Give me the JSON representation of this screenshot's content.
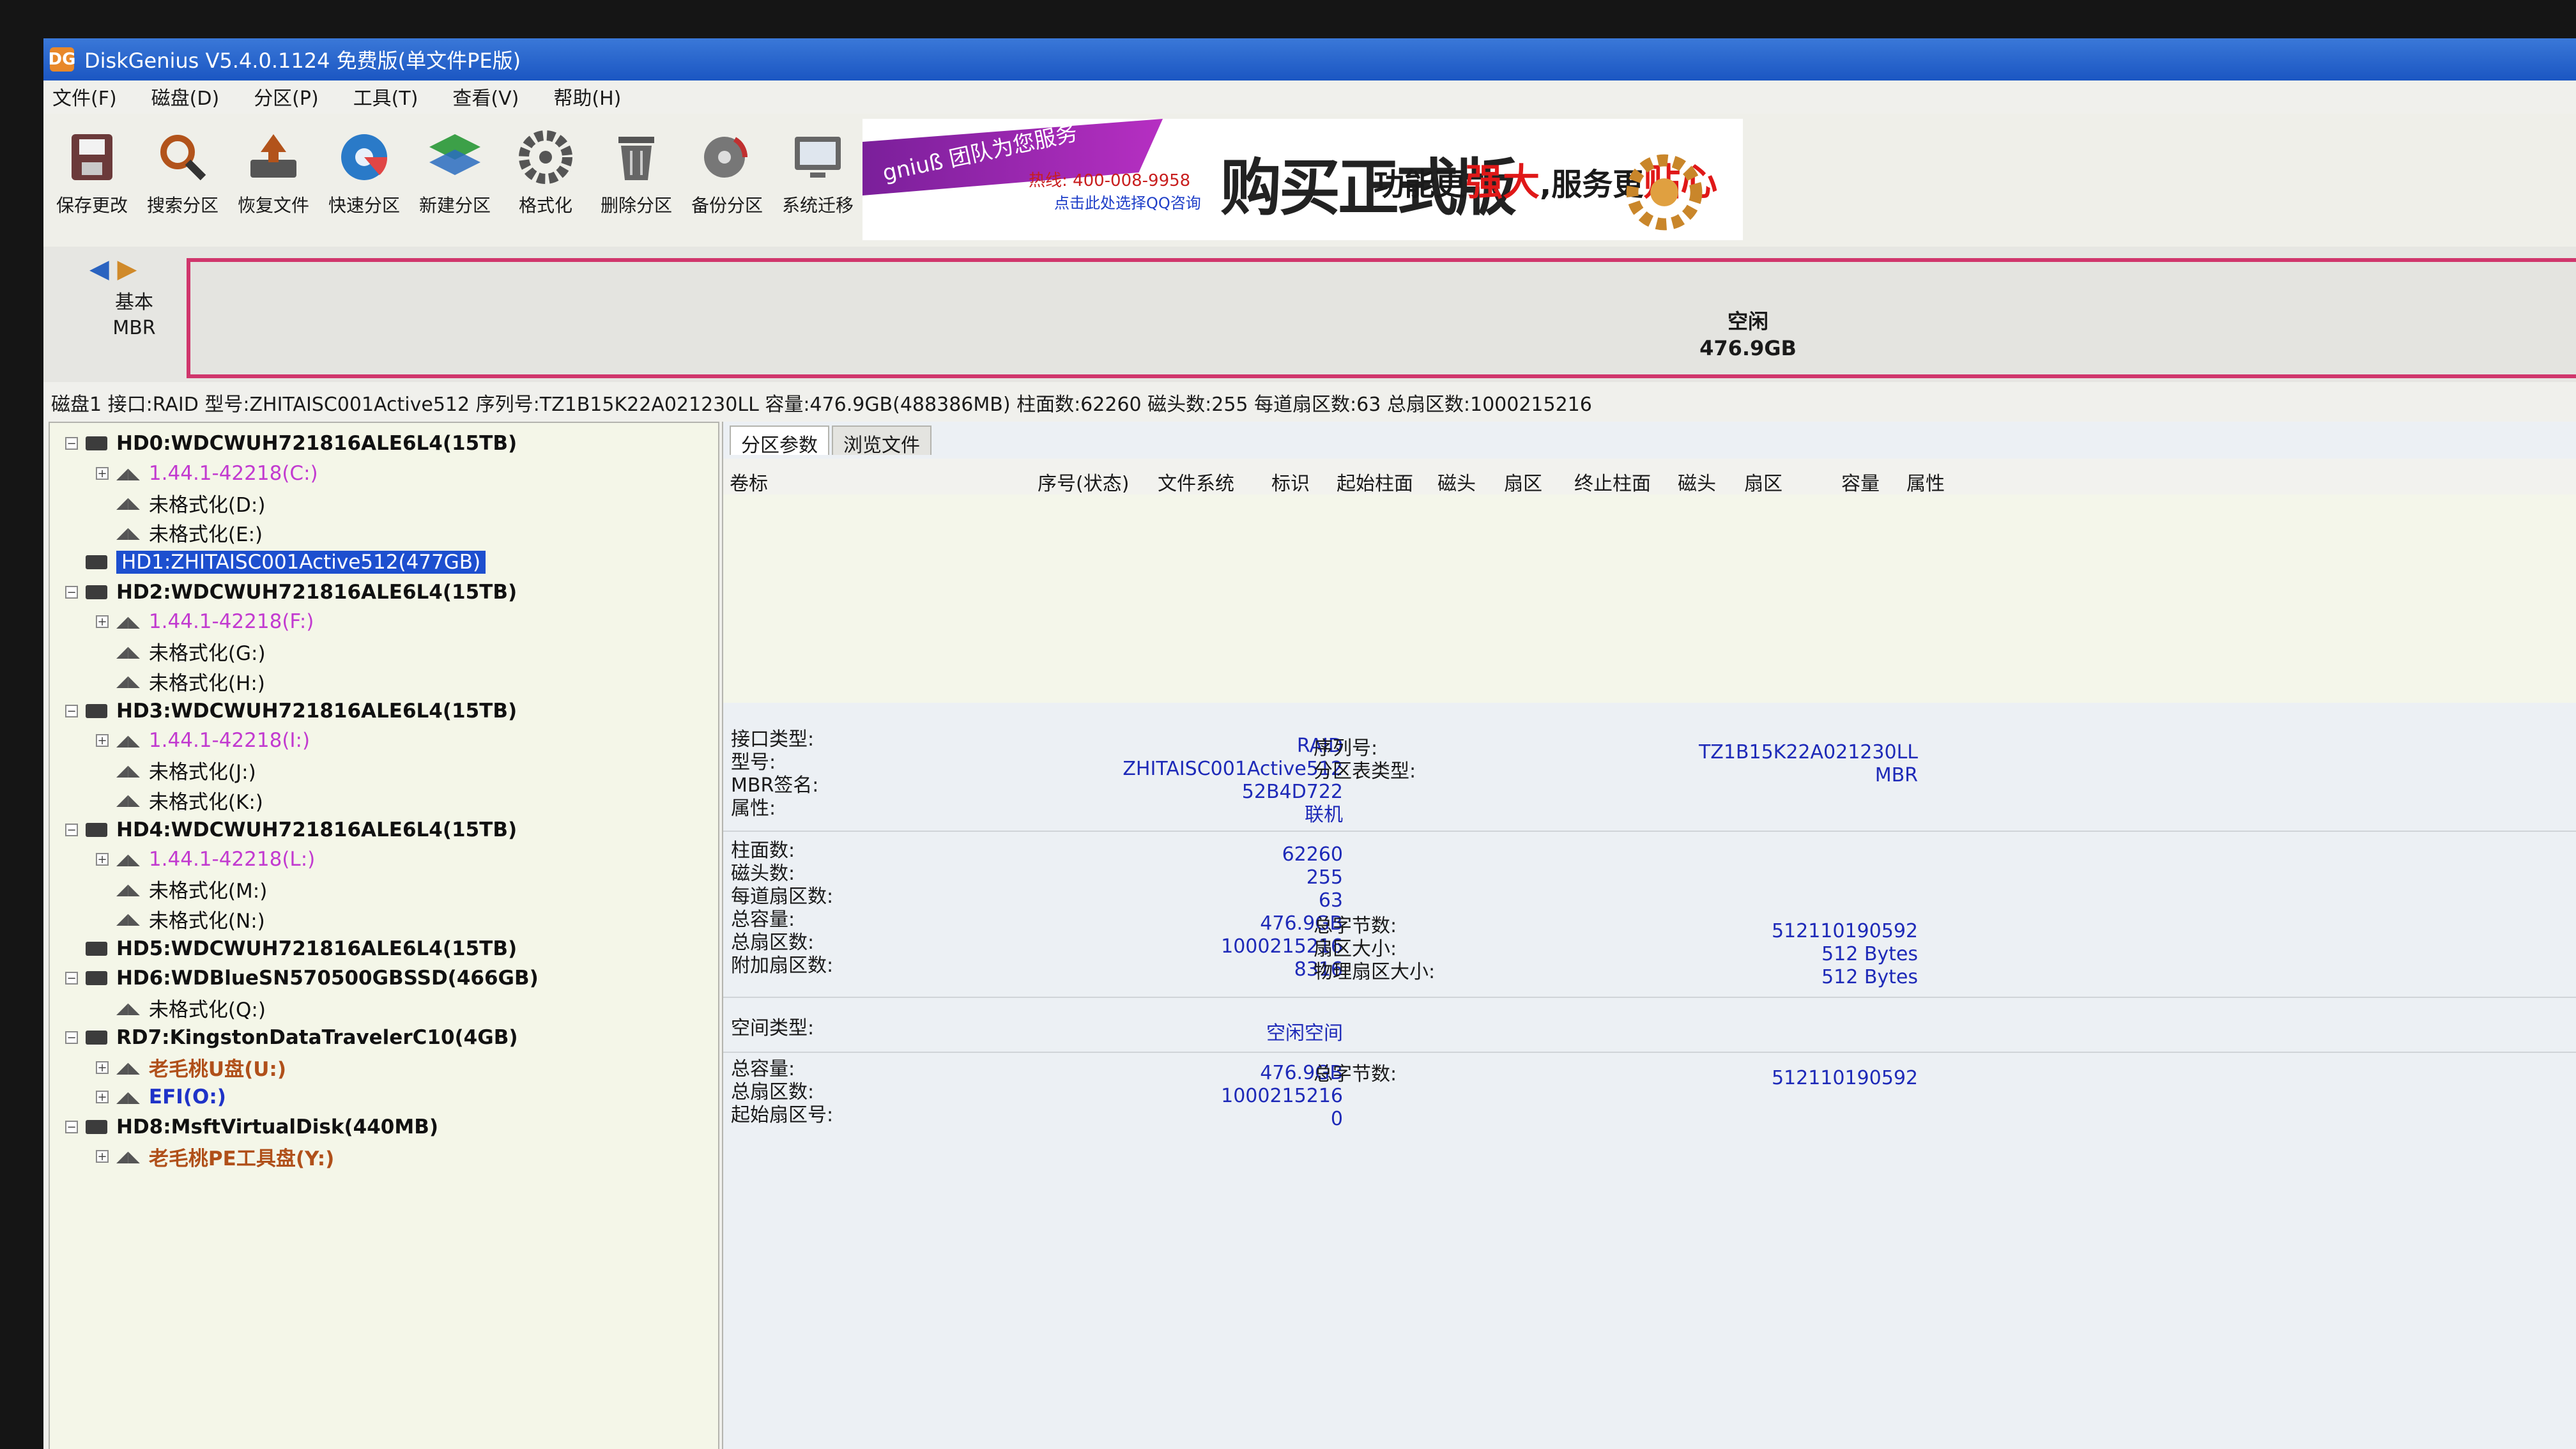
{
  "window": {
    "title": "DiskGenius V5.4.0.1124 免费版(单文件PE版)",
    "app_icon": "DG"
  },
  "menu": [
    "文件(F)",
    "磁盘(D)",
    "分区(P)",
    "工具(T)",
    "查看(V)",
    "帮助(H)"
  ],
  "toolbar": [
    {
      "label": "保存更改",
      "icon": "save-icon"
    },
    {
      "label": "搜索分区",
      "icon": "search-icon"
    },
    {
      "label": "恢复文件",
      "icon": "recover-icon"
    },
    {
      "label": "快速分区",
      "icon": "quick-partition-icon"
    },
    {
      "label": "新建分区",
      "icon": "new-partition-icon"
    },
    {
      "label": "格式化",
      "icon": "format-icon"
    },
    {
      "label": "删除分区",
      "icon": "delete-icon"
    },
    {
      "label": "备份分区",
      "icon": "backup-icon"
    },
    {
      "label": "系统迁移",
      "icon": "migrate-icon"
    }
  ],
  "ad": {
    "ribbon": "gniuß 团队为您服务",
    "phone": "热线: 400-008-9958",
    "qq": "点击此处选择QQ咨询",
    "big": "购买正式版",
    "slogan_a": "功能更",
    "slogan_b": "强大",
    "slogan_c": ",服务更",
    "slogan_d": "贴心"
  },
  "disk_strip": {
    "line1": "基本",
    "line2": "MBR",
    "part_label": "空闲",
    "part_size": "476.9GB",
    "colors": {
      "border": "#d0366c"
    }
  },
  "info_line": "磁盘1 接口:RAID  型号:ZHITAISC001Active512  序列号:TZ1B15K22A021230LL  容量:476.9GB(488386MB)  柱面数:62260  磁头数:255  每道扇区数:63  总扇区数:1000215216",
  "tree": [
    {
      "kind": "disk",
      "label": "HD0:WDCWUH721816ALE6L4(15TB)",
      "box": "−",
      "class": "c-disk",
      "depth": 0
    },
    {
      "kind": "part",
      "label": "1.44.1-42218(C:)",
      "box": "+",
      "class": "c-part",
      "depth": 1
    },
    {
      "kind": "part",
      "label": "未格式化(D:)",
      "box": "",
      "class": "c-unfmt",
      "depth": 1
    },
    {
      "kind": "part",
      "label": "未格式化(E:)",
      "box": "",
      "class": "c-unfmt",
      "depth": 1
    },
    {
      "kind": "disk",
      "label": "HD1:ZHITAISC001Active512(477GB)",
      "box": "",
      "class": "sel",
      "depth": 0
    },
    {
      "kind": "disk",
      "label": "HD2:WDCWUH721816ALE6L4(15TB)",
      "box": "−",
      "class": "c-disk",
      "depth": 0
    },
    {
      "kind": "part",
      "label": "1.44.1-42218(F:)",
      "box": "+",
      "class": "c-part",
      "depth": 1
    },
    {
      "kind": "part",
      "label": "未格式化(G:)",
      "box": "",
      "class": "c-unfmt",
      "depth": 1
    },
    {
      "kind": "part",
      "label": "未格式化(H:)",
      "box": "",
      "class": "c-unfmt",
      "depth": 1
    },
    {
      "kind": "disk",
      "label": "HD3:WDCWUH721816ALE6L4(15TB)",
      "box": "−",
      "class": "c-disk",
      "depth": 0
    },
    {
      "kind": "part",
      "label": "1.44.1-42218(I:)",
      "box": "+",
      "class": "c-part",
      "depth": 1
    },
    {
      "kind": "part",
      "label": "未格式化(J:)",
      "box": "",
      "class": "c-unfmt",
      "depth": 1
    },
    {
      "kind": "part",
      "label": "未格式化(K:)",
      "box": "",
      "class": "c-unfmt",
      "depth": 1
    },
    {
      "kind": "disk",
      "label": "HD4:WDCWUH721816ALE6L4(15TB)",
      "box": "−",
      "class": "c-disk",
      "depth": 0
    },
    {
      "kind": "part",
      "label": "1.44.1-42218(L:)",
      "box": "+",
      "class": "c-part",
      "depth": 1
    },
    {
      "kind": "part",
      "label": "未格式化(M:)",
      "box": "",
      "class": "c-unfmt",
      "depth": 1
    },
    {
      "kind": "part",
      "label": "未格式化(N:)",
      "box": "",
      "class": "c-unfmt",
      "depth": 1
    },
    {
      "kind": "disk",
      "label": "HD5:WDCWUH721816ALE6L4(15TB)",
      "box": "",
      "class": "c-disk",
      "depth": 0
    },
    {
      "kind": "disk",
      "label": "HD6:WDBlueSN570500GBSSD(466GB)",
      "box": "−",
      "class": "c-disk",
      "depth": 0
    },
    {
      "kind": "part",
      "label": "未格式化(Q:)",
      "box": "",
      "class": "c-unfmt",
      "depth": 1
    },
    {
      "kind": "disk",
      "label": "RD7:KingstonDataTravelerC10(4GB)",
      "box": "−",
      "class": "c-disk",
      "depth": 0
    },
    {
      "kind": "part",
      "label": "老毛桃U盘(U:)",
      "box": "+",
      "class": "c-usb",
      "depth": 1
    },
    {
      "kind": "part",
      "label": "EFI(O:)",
      "box": "+",
      "class": "c-efi",
      "depth": 1
    },
    {
      "kind": "disk",
      "label": "HD8:MsftVirtualDisk(440MB)",
      "box": "−",
      "class": "c-disk",
      "depth": 0
    },
    {
      "kind": "part",
      "label": "老毛桃PE工具盘(Y:)",
      "box": "+",
      "class": "c-usb",
      "depth": 1
    }
  ],
  "tabs": [
    "分区参数",
    "浏览文件"
  ],
  "columns": [
    "卷标",
    "序号(状态)",
    "文件系统",
    "标识",
    "起始柱面",
    "磁头",
    "扇区",
    "终止柱面",
    "磁头",
    "扇区",
    "容量",
    "属性"
  ],
  "details": {
    "iface_label": "接口类型:",
    "iface": "RAID",
    "model_label": "型号:",
    "model": "ZHITAISC001Active512",
    "mbrsig_label": "MBR签名:",
    "mbrsig": "52B4D722",
    "attr_label": "属性:",
    "attr": "联机",
    "serial_label": "序列号:",
    "serial": "TZ1B15K22A021230LL",
    "ptable_label": "分区表类型:",
    "ptable": "MBR",
    "cyl_label": "柱面数:",
    "cyl": "62260",
    "heads_label": "磁头数:",
    "heads": "255",
    "spt_label": "每道扇区数:",
    "spt": "63",
    "cap_label": "总容量:",
    "cap": "476.9GB",
    "sectors_label": "总扇区数:",
    "sectors": "1000215216",
    "extra_label": "附加扇区数:",
    "extra": "8316",
    "bytes_label": "总字节数:",
    "bytes": "512110190592",
    "secsize_label": "扇区大小:",
    "secsize": "512 Bytes",
    "physec_label": "物理扇区大小:",
    "physec": "512 Bytes",
    "space_label": "空间类型:",
    "space": "空闲空间",
    "fcap_label": "总容量:",
    "fcap": "476.9GB",
    "fsectors_label": "总扇区数:",
    "fsectors": "1000215216",
    "fstart_label": "起始扇区号:",
    "fstart": "0",
    "fbytes_label": "总字节数:",
    "fbytes": "512110190592"
  }
}
